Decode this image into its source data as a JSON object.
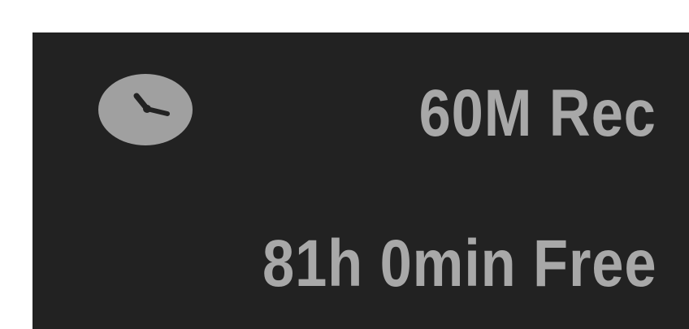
{
  "osd": {
    "icon": "clock-icon",
    "record_mode": "60M Rec",
    "free_space": "81h 0min Free"
  },
  "colors": {
    "panel_background": "#222222",
    "text": "#a8a8a8",
    "icon_fill": "#a0a0a0"
  }
}
